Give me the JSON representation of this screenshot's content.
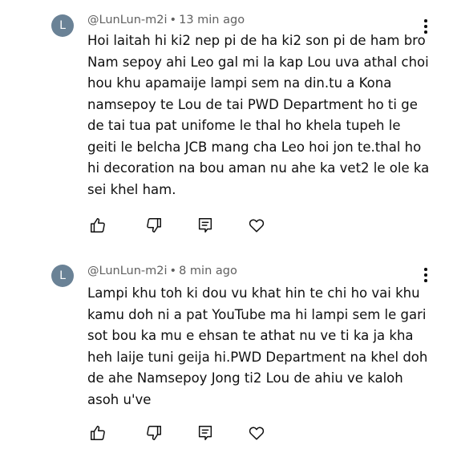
{
  "comments": [
    {
      "avatar_letter": "L",
      "author": "@LunLun-m2i",
      "separator": "•",
      "time": "13 min ago",
      "text": "Hoi laitah hi ki2 nep pi de ha ki2 son pi de ham bro\nNam sepoy ahi Leo gal mi la kap Lou uva athal choi\nhou khu apamaije lampi sem na din.tu a Kona\nnamsepoy te Lou de tai  PWD Department ho ti ge\nde tai tua pat unifome le thal ho khela tupeh le\ngeiti le belcha JCB mang cha Leo hoi jon te.thal ho\nhi decoration na bou aman nu ahe ka vet2 le ole ka\nsei khel ham."
    },
    {
      "avatar_letter": "L",
      "author": "@LunLun-m2i",
      "separator": "•",
      "time": "8 min ago",
      "text": "Lampi khu toh ki dou vu khat hin te chi ho vai khu\nkamu doh ni a pat YouTube ma hi lampi sem le gari\nsot bou ka mu e ehsan te athat nu ve ti ka ja kha\nheh laije tuni geija hi.PWD Department na khel doh\nde ahe Namsepoy Jong ti2 Lou de ahiu ve kaloh\nasoh u've"
    }
  ],
  "icons": {
    "more": "more-vert-icon",
    "like": "thumb-up-icon",
    "dislike": "thumb-down-icon",
    "reply": "reply-icon",
    "heart": "heart-icon"
  },
  "colors": {
    "avatar_bg": "#6a8296",
    "meta_text": "#606060",
    "body_text": "#0f0f0f",
    "background": "#ffffff"
  }
}
